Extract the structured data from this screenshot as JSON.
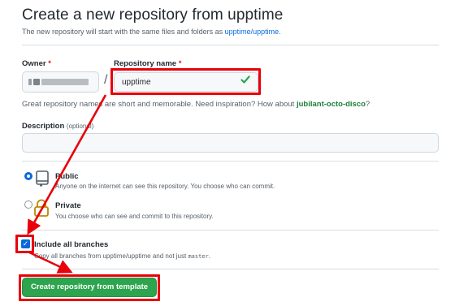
{
  "header": {
    "title": "Create a new repository from upptime",
    "subtitle_prefix": "The new repository will start with the same files and folders as ",
    "subtitle_link": "upptime/upptime",
    "subtitle_suffix": "."
  },
  "owner": {
    "label": "Owner",
    "required_mark": "*",
    "separator": "/"
  },
  "repo_name": {
    "label": "Repository name",
    "required_mark": "*",
    "value": "upptime",
    "valid_icon": "check-icon"
  },
  "hint": {
    "prefix": "Great repository names are short and memorable. Need inspiration? How about ",
    "suggestion": "jubilant-octo-disco",
    "suffix": "?"
  },
  "description": {
    "label": "Description",
    "optional": "(optional)",
    "value": ""
  },
  "visibility": {
    "public": {
      "title": "Public",
      "desc": "Anyone on the internet can see this repository. You choose who can commit.",
      "selected": true,
      "icon": "repo-icon"
    },
    "private": {
      "title": "Private",
      "desc": "You choose who can see and commit to this repository.",
      "selected": false,
      "icon": "lock-icon"
    }
  },
  "include_branches": {
    "label": "Include all branches",
    "desc_prefix": "Copy all branches from upptime/upptime and not just ",
    "desc_code": "master",
    "desc_suffix": ".",
    "checked": true
  },
  "submit": {
    "label": "Create repository from template"
  },
  "colors": {
    "accent": "#0969da",
    "primary_button": "#2da44e",
    "annotation": "#e8000b",
    "success": "#1a7f37"
  }
}
